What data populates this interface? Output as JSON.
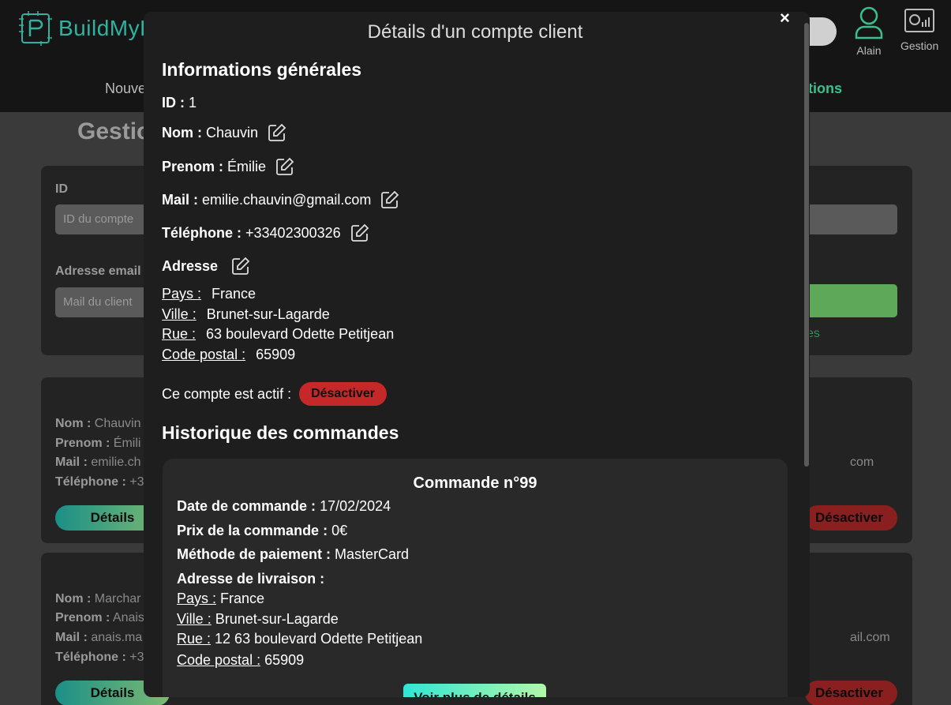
{
  "app": {
    "logo_text": "BuildMyP"
  },
  "header": {
    "user_label": "Alain",
    "gestion_label": "Gestion",
    "nav_left": "Nouve",
    "nav_right": "otions"
  },
  "page": {
    "title": "Gestic"
  },
  "filters": {
    "id_label": "ID",
    "id_placeholder": "ID du compte",
    "email_label": "Adresse email",
    "email_placeholder": "Mail du client",
    "link_fragment": "es"
  },
  "client_cards": [
    {
      "nom_label": "Nom :",
      "nom": "Chauvin",
      "prenom_label": "Prenom :",
      "prenom": "Émili",
      "mail_label": "Mail :",
      "mail": "emilie.ch",
      "tel_label": "Téléphone :",
      "tel": "+3",
      "mail_right": "com",
      "details_label": "Détails",
      "deactivate_label": "Désactiver"
    },
    {
      "nom_label": "Nom :",
      "nom": "Marchar",
      "prenom_label": "Prenom :",
      "prenom": "Anais",
      "mail_label": "Mail :",
      "mail": "anais.ma",
      "tel_label": "Téléphone :",
      "tel": "+3",
      "mail_right": "ail.com",
      "details_label": "Détails",
      "deactivate_label": "Désactiver"
    }
  ],
  "modal": {
    "title": "Détails d'un compte client",
    "close_glyph": "×",
    "general_heading": "Informations générales",
    "id_label": "ID :",
    "id_value": "1",
    "nom_label": "Nom :",
    "nom_value": "Chauvin",
    "prenom_label": "Prenom :",
    "prenom_value": "Émilie",
    "mail_label": "Mail :",
    "mail_value": "emilie.chauvin@gmail.com",
    "tel_label": "Téléphone :",
    "tel_value": "+33402300326",
    "adresse_label": "Adresse",
    "pays_label": "Pays :",
    "pays_value": "France",
    "ville_label": "Ville :",
    "ville_value": "Brunet-sur-Lagarde",
    "rue_label": "Rue :",
    "rue_value": "63 boulevard Odette Petitjean",
    "cp_label": "Code postal :",
    "cp_value": "65909",
    "active_text": "Ce compte est actif :",
    "deactivate_label": "Désactiver",
    "history_heading": "Historique des commandes"
  },
  "order": {
    "title": "Commande n°99",
    "date_label": "Date de commande :",
    "date_value": "17/02/2024",
    "price_label": "Prix de la commande :",
    "price_value": "0€",
    "payment_label": "Méthode de paiement :",
    "payment_value": "MasterCard",
    "shipping_label": "Adresse de livraison :",
    "pays_label": "Pays :",
    "pays_value": "France",
    "ville_label": "Ville :",
    "ville_value": "Brunet-sur-Lagarde",
    "rue_label": "Rue :",
    "rue_value": "12 63 boulevard Odette Petitjean",
    "cp_label": "Code postal :",
    "cp_value": "65909",
    "more_label": "Voir plus de détails"
  },
  "colors": {
    "accent": "#2fb3a0",
    "danger": "#c42828",
    "modal_bg": "#1e1e1e"
  }
}
